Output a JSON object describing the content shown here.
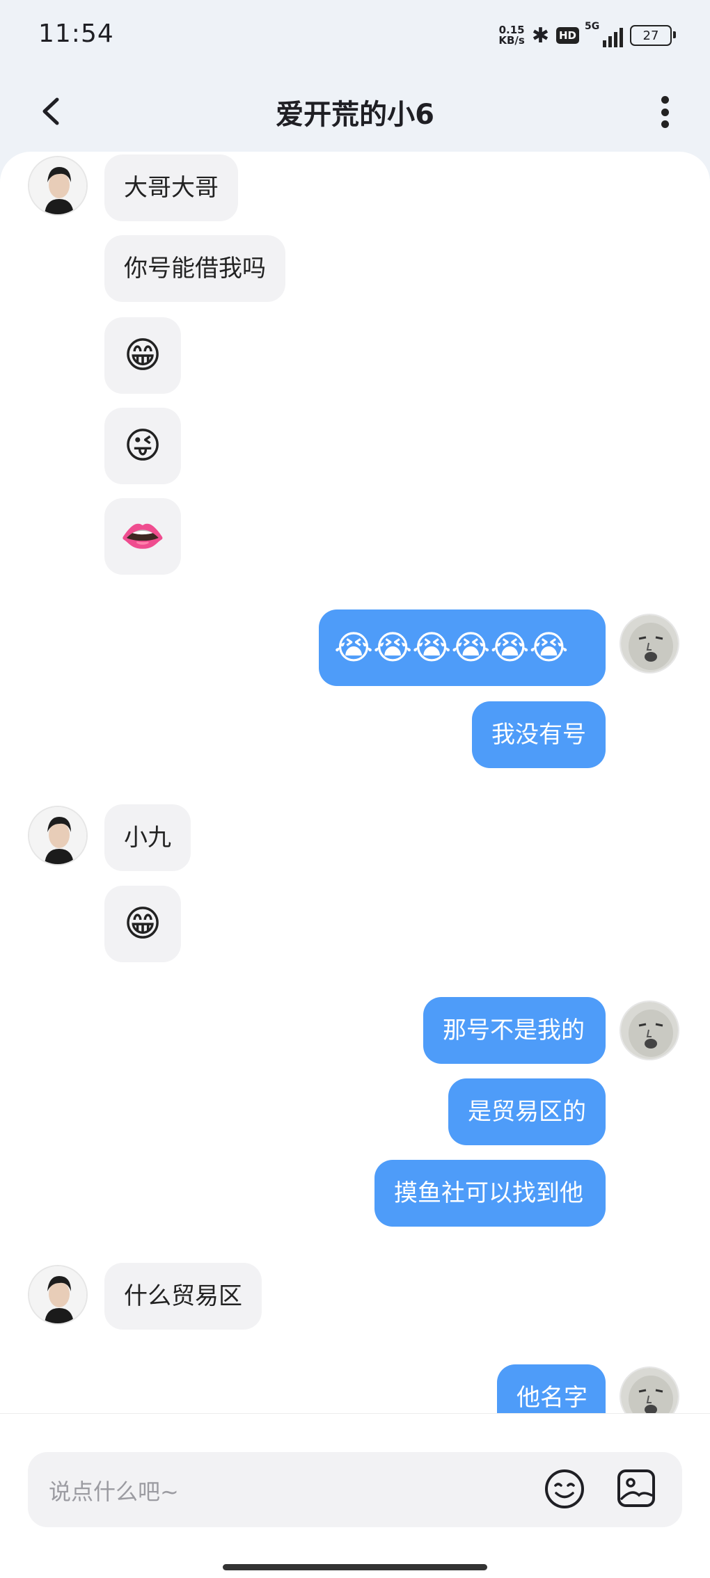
{
  "status_bar": {
    "time": "11:54",
    "net_speed_value": "0.15",
    "net_speed_unit": "KB/s",
    "hd": "HD",
    "network": "5G",
    "battery": "27"
  },
  "header": {
    "title": "爱开荒的小6",
    "back_icon": "chevron-left-icon",
    "more_icon": "more-vertical-icon"
  },
  "messages": [
    {
      "from": "other",
      "text": "大哥大哥"
    },
    {
      "from": "other",
      "text": "你号能借我吗"
    },
    {
      "from": "other",
      "emoji": "😁"
    },
    {
      "from": "other",
      "emoji": "😜"
    },
    {
      "from": "other",
      "emoji": "👄"
    },
    {
      "from": "me",
      "emoji": "😭😭😭😭😭😭"
    },
    {
      "from": "me",
      "text": "我没有号"
    },
    {
      "from": "other",
      "text": "小九"
    },
    {
      "from": "other",
      "emoji": "😁"
    },
    {
      "from": "me",
      "text": "那号不是我的"
    },
    {
      "from": "me",
      "text": "是贸易区的"
    },
    {
      "from": "me",
      "text": "摸鱼社可以找到他"
    },
    {
      "from": "other",
      "text": "什么贸易区"
    },
    {
      "from": "me",
      "text": "他名字"
    }
  ],
  "input": {
    "placeholder": "说点什么吧~",
    "emoji_icon": "smiley-icon",
    "sticker_icon": "sticker-icon"
  },
  "colors": {
    "outgoing_bubble": "#4e9cf9",
    "incoming_bubble": "#f2f2f4",
    "header_bg": "#eef2f7"
  }
}
